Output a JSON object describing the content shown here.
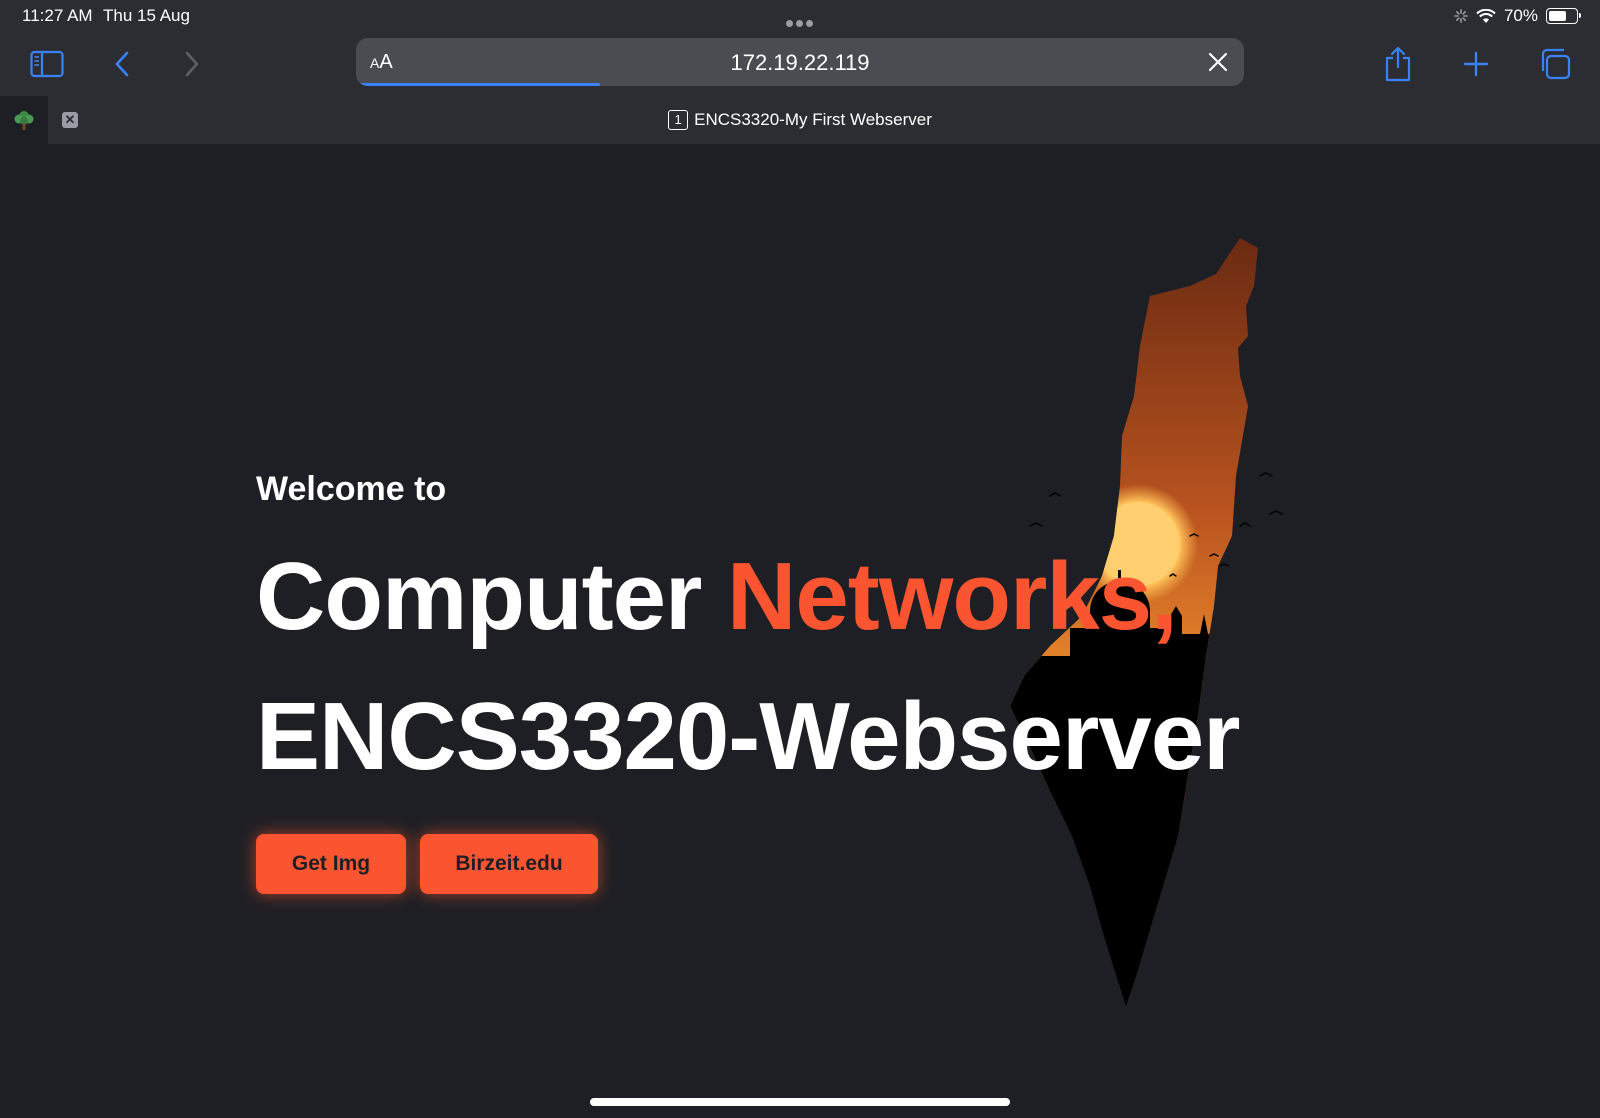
{
  "status_bar": {
    "time": "11:27 AM",
    "date": "Thu 15 Aug",
    "battery_percent": "70%",
    "battery_level": 0.7
  },
  "toolbar": {
    "icons": [
      "sidebar-icon",
      "back-icon",
      "forward-icon",
      "share-icon",
      "add-tab-icon",
      "tabs-overview-icon"
    ],
    "reader_label": "AA",
    "url": "172.19.22.119",
    "load_progress": 0.27
  },
  "tab": {
    "count": "1",
    "title": "ENCS3320-My First Webserver"
  },
  "hero": {
    "welcome": "Welcome to",
    "headline_part1": "Computer ",
    "headline_accent": "Networks,",
    "headline_line2": "ENCS3320-Webserver",
    "buttons": {
      "get_img": "Get Img",
      "birzeit": "Birzeit.edu"
    }
  },
  "colors": {
    "background": "#1e1f24",
    "chrome": "#2b2d33",
    "accent": "#fa5530",
    "link_blue": "#3b82f6"
  }
}
